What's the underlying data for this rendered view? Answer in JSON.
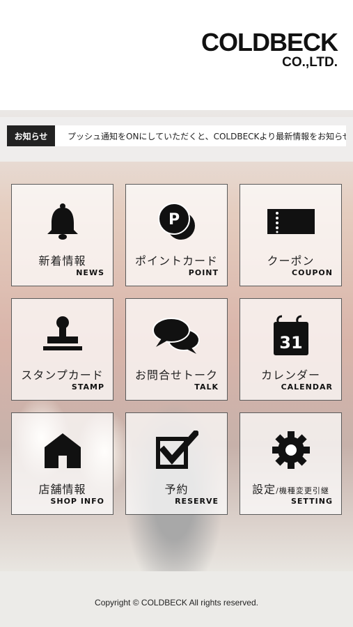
{
  "header": {
    "logo_main": "COLDBECK",
    "logo_sub": "CO.,LTD."
  },
  "notice": {
    "label": "お知らせ",
    "text": "プッシュ通知をONにしていただくと、COLDBECKより最新情報をお知らせします"
  },
  "menu": [
    {
      "jp": "新着情報",
      "en": "NEWS",
      "icon": "bell-icon"
    },
    {
      "jp": "ポイントカード",
      "en": "POINT",
      "icon": "point-coin-icon"
    },
    {
      "jp": "クーポン",
      "en": "COUPON",
      "icon": "ticket-icon"
    },
    {
      "jp": "スタンプカード",
      "en": "STAMP",
      "icon": "stamp-icon"
    },
    {
      "jp": "お問合せトーク",
      "en": "TALK",
      "icon": "chat-bubbles-icon"
    },
    {
      "jp": "カレンダー",
      "en": "CALENDAR",
      "icon": "calendar-icon",
      "day": "31"
    },
    {
      "jp": "店舗情報",
      "en": "SHOP INFO",
      "icon": "house-icon"
    },
    {
      "jp": "予約",
      "en": "RESERVE",
      "icon": "checkbox-icon"
    },
    {
      "jp": "設定",
      "jp_small": "/機種変更引継",
      "en": "SETTING",
      "icon": "gear-icon"
    }
  ],
  "footer": {
    "copyright": "Copyright © COLDBECK All rights reserved."
  }
}
